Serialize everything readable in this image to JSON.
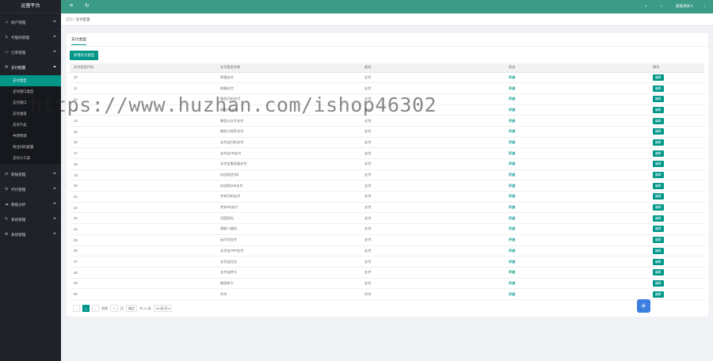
{
  "app": {
    "title": "运营平台"
  },
  "sidebar": {
    "groups": [
      {
        "label": "商户管理",
        "icon": "user-icon"
      },
      {
        "label": "代理商管理",
        "icon": "agent-icon"
      },
      {
        "label": "订单管理",
        "icon": "order-icon"
      },
      {
        "label": "支付配置",
        "icon": "settings-icon",
        "open": true
      },
      {
        "label": "转账管理",
        "icon": "transfer-icon"
      },
      {
        "label": "代付管理",
        "icon": "payout-icon"
      },
      {
        "label": "数据分析",
        "icon": "chart-icon"
      },
      {
        "label": "系统管理",
        "icon": "system-icon"
      },
      {
        "label": "系统管理",
        "icon": "gear-icon"
      }
    ],
    "sub_items": [
      "支付类型",
      "支付接口类型",
      "支付接口",
      "支付通道",
      "支付产品",
      "中转管理",
      "商业扫码配置",
      "支付小工具"
    ]
  },
  "header": {
    "user_label": "超级测试"
  },
  "breadcrumb": {
    "home": "首页",
    "current": "支付配置"
  },
  "tab": {
    "label": "支付类型"
  },
  "toolbar": {
    "add_label": "新增支付类型"
  },
  "table": {
    "headers": [
      "支付类型代码",
      "支付类型名称",
      "类别",
      "状态",
      "操作"
    ],
    "rows": [
      {
        "code": "10",
        "name": "网银支付",
        "type": "支付",
        "status": "开启"
      },
      {
        "code": "11",
        "name": "快捷支付",
        "type": "支付",
        "status": "开启"
      },
      {
        "code": "12",
        "name": "微信扫码支付",
        "type": "支付",
        "status": "开启"
      },
      {
        "code": "13",
        "name": "微信H5支付",
        "type": "支付",
        "status": "开启"
      },
      {
        "code": "14",
        "name": "微信公众号支付",
        "type": "支付",
        "status": "开启"
      },
      {
        "code": "15",
        "name": "微信小程序支付",
        "type": "支付",
        "status": "开启"
      },
      {
        "code": "16",
        "name": "支付宝扫码支付",
        "type": "支付",
        "status": "开启"
      },
      {
        "code": "17",
        "name": "支付宝H5支付",
        "type": "支付",
        "status": "开启"
      },
      {
        "code": "18",
        "name": "支付宝服务窗支付",
        "type": "支付",
        "status": "开启"
      },
      {
        "code": "19",
        "name": "QQ钱包扫码",
        "type": "支付",
        "status": "开启"
      },
      {
        "code": "20",
        "name": "QQ钱包H5支付",
        "type": "支付",
        "status": "开启"
      },
      {
        "code": "21",
        "name": "京东扫码支付",
        "type": "支付",
        "status": "开启"
      },
      {
        "code": "22",
        "name": "京东H5支付",
        "type": "支付",
        "status": "开启"
      },
      {
        "code": "23",
        "name": "百度钱包",
        "type": "支付",
        "status": "开启"
      },
      {
        "code": "24",
        "name": "银联二维码",
        "type": "支付",
        "status": "开启"
      },
      {
        "code": "25",
        "name": "云闪付支付",
        "type": "支付",
        "status": "开启"
      },
      {
        "code": "26",
        "name": "支付宝APP支付",
        "type": "支付",
        "status": "开启"
      },
      {
        "code": "27",
        "name": "支付宝红包",
        "type": "支付",
        "status": "开启"
      },
      {
        "code": "28",
        "name": "支付宝转卡",
        "type": "支付",
        "status": "开启"
      },
      {
        "code": "29",
        "name": "微信转卡",
        "type": "支付",
        "status": "开启"
      },
      {
        "code": "90",
        "name": "代付",
        "type": "代付",
        "status": "开启"
      }
    ],
    "edit_label": "编辑"
  },
  "pager": {
    "current": "1",
    "goto_prefix": "到第",
    "goto_value": "1",
    "goto_suffix": "页",
    "confirm": "确定",
    "total": "共 21 条",
    "page_size": "30 条/页"
  },
  "watermark": "https://www.huzhan.com/ishop46302",
  "colors": {
    "accent": "#009688",
    "header": "#3c9b86",
    "sidebar": "#20222a"
  }
}
